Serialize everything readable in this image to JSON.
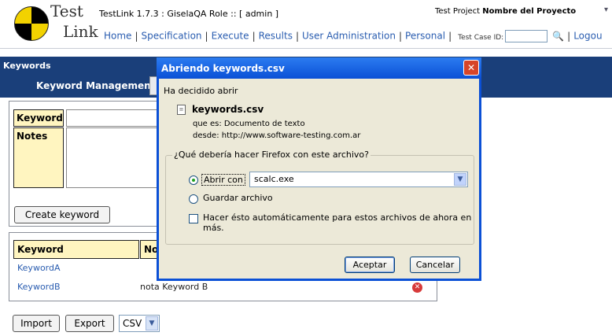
{
  "header": {
    "logo_top": "Test",
    "logo_bottom": "Link",
    "app_title": "TestLink 1.7.3 : GiselaQA Role :: [ admin ]",
    "project_label": "Test Project",
    "project_name": "Nombre del Proyecto"
  },
  "nav": {
    "items": [
      "Home",
      "Specification",
      "Execute",
      "Results",
      "User Administration",
      "Personal"
    ],
    "test_case_label": "Test Case ID:",
    "test_case_value": "",
    "logout": "Logou"
  },
  "keywords": {
    "section_title": "Keywords",
    "tab_label": "Keyword Management",
    "form": {
      "keyword_label": "Keyword",
      "notes_label": "Notes",
      "keyword_value": "",
      "notes_value": "",
      "create_button": "Create keyword"
    },
    "table": {
      "headers": [
        "Keyword",
        "No"
      ],
      "rows": [
        {
          "keyword": "KeywordA",
          "notes": ""
        },
        {
          "keyword": "KeywordB",
          "notes": "nota Keyword B"
        }
      ]
    },
    "import_button": "Import",
    "export_button": "Export",
    "format_select": "CSV"
  },
  "dialog": {
    "title": "Abriendo keywords.csv",
    "open_text": "Ha decidido abrir",
    "file_name": "keywords.csv",
    "type_line": "que es:  Documento de texto",
    "from_line": "desde:  http://www.software-testing.com.ar",
    "question": "¿Qué debería hacer Firefox con este archivo?",
    "open_with_label": "Abrir con",
    "open_with_app": "scalc.exe",
    "save_label": "Guardar archivo",
    "auto_label": "Hacer ésto automáticamente para estos archivos de ahora en más.",
    "accept": "Aceptar",
    "cancel": "Cancelar"
  }
}
